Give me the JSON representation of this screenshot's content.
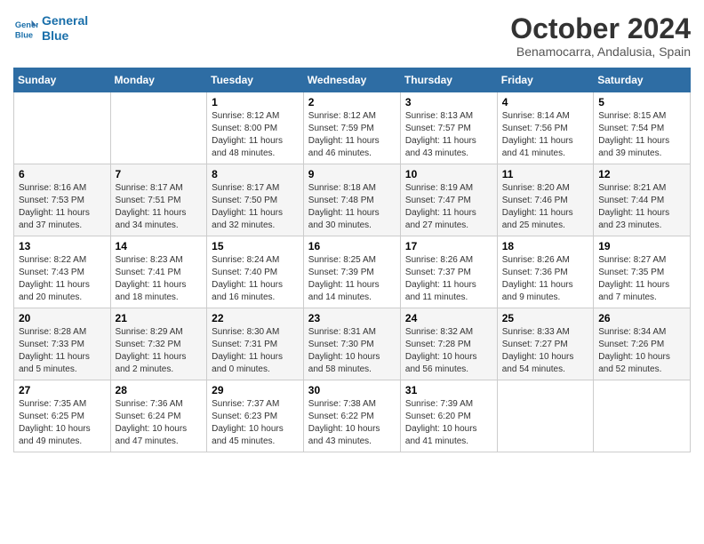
{
  "header": {
    "logo_line1": "General",
    "logo_line2": "Blue",
    "title": "October 2024",
    "subtitle": "Benamocarra, Andalusia, Spain"
  },
  "columns": [
    "Sunday",
    "Monday",
    "Tuesday",
    "Wednesday",
    "Thursday",
    "Friday",
    "Saturday"
  ],
  "weeks": [
    [
      {
        "day": "",
        "sunrise": "",
        "sunset": "",
        "daylight": ""
      },
      {
        "day": "",
        "sunrise": "",
        "sunset": "",
        "daylight": ""
      },
      {
        "day": "1",
        "sunrise": "Sunrise: 8:12 AM",
        "sunset": "Sunset: 8:00 PM",
        "daylight": "Daylight: 11 hours and 48 minutes."
      },
      {
        "day": "2",
        "sunrise": "Sunrise: 8:12 AM",
        "sunset": "Sunset: 7:59 PM",
        "daylight": "Daylight: 11 hours and 46 minutes."
      },
      {
        "day": "3",
        "sunrise": "Sunrise: 8:13 AM",
        "sunset": "Sunset: 7:57 PM",
        "daylight": "Daylight: 11 hours and 43 minutes."
      },
      {
        "day": "4",
        "sunrise": "Sunrise: 8:14 AM",
        "sunset": "Sunset: 7:56 PM",
        "daylight": "Daylight: 11 hours and 41 minutes."
      },
      {
        "day": "5",
        "sunrise": "Sunrise: 8:15 AM",
        "sunset": "Sunset: 7:54 PM",
        "daylight": "Daylight: 11 hours and 39 minutes."
      }
    ],
    [
      {
        "day": "6",
        "sunrise": "Sunrise: 8:16 AM",
        "sunset": "Sunset: 7:53 PM",
        "daylight": "Daylight: 11 hours and 37 minutes."
      },
      {
        "day": "7",
        "sunrise": "Sunrise: 8:17 AM",
        "sunset": "Sunset: 7:51 PM",
        "daylight": "Daylight: 11 hours and 34 minutes."
      },
      {
        "day": "8",
        "sunrise": "Sunrise: 8:17 AM",
        "sunset": "Sunset: 7:50 PM",
        "daylight": "Daylight: 11 hours and 32 minutes."
      },
      {
        "day": "9",
        "sunrise": "Sunrise: 8:18 AM",
        "sunset": "Sunset: 7:48 PM",
        "daylight": "Daylight: 11 hours and 30 minutes."
      },
      {
        "day": "10",
        "sunrise": "Sunrise: 8:19 AM",
        "sunset": "Sunset: 7:47 PM",
        "daylight": "Daylight: 11 hours and 27 minutes."
      },
      {
        "day": "11",
        "sunrise": "Sunrise: 8:20 AM",
        "sunset": "Sunset: 7:46 PM",
        "daylight": "Daylight: 11 hours and 25 minutes."
      },
      {
        "day": "12",
        "sunrise": "Sunrise: 8:21 AM",
        "sunset": "Sunset: 7:44 PM",
        "daylight": "Daylight: 11 hours and 23 minutes."
      }
    ],
    [
      {
        "day": "13",
        "sunrise": "Sunrise: 8:22 AM",
        "sunset": "Sunset: 7:43 PM",
        "daylight": "Daylight: 11 hours and 20 minutes."
      },
      {
        "day": "14",
        "sunrise": "Sunrise: 8:23 AM",
        "sunset": "Sunset: 7:41 PM",
        "daylight": "Daylight: 11 hours and 18 minutes."
      },
      {
        "day": "15",
        "sunrise": "Sunrise: 8:24 AM",
        "sunset": "Sunset: 7:40 PM",
        "daylight": "Daylight: 11 hours and 16 minutes."
      },
      {
        "day": "16",
        "sunrise": "Sunrise: 8:25 AM",
        "sunset": "Sunset: 7:39 PM",
        "daylight": "Daylight: 11 hours and 14 minutes."
      },
      {
        "day": "17",
        "sunrise": "Sunrise: 8:26 AM",
        "sunset": "Sunset: 7:37 PM",
        "daylight": "Daylight: 11 hours and 11 minutes."
      },
      {
        "day": "18",
        "sunrise": "Sunrise: 8:26 AM",
        "sunset": "Sunset: 7:36 PM",
        "daylight": "Daylight: 11 hours and 9 minutes."
      },
      {
        "day": "19",
        "sunrise": "Sunrise: 8:27 AM",
        "sunset": "Sunset: 7:35 PM",
        "daylight": "Daylight: 11 hours and 7 minutes."
      }
    ],
    [
      {
        "day": "20",
        "sunrise": "Sunrise: 8:28 AM",
        "sunset": "Sunset: 7:33 PM",
        "daylight": "Daylight: 11 hours and 5 minutes."
      },
      {
        "day": "21",
        "sunrise": "Sunrise: 8:29 AM",
        "sunset": "Sunset: 7:32 PM",
        "daylight": "Daylight: 11 hours and 2 minutes."
      },
      {
        "day": "22",
        "sunrise": "Sunrise: 8:30 AM",
        "sunset": "Sunset: 7:31 PM",
        "daylight": "Daylight: 11 hours and 0 minutes."
      },
      {
        "day": "23",
        "sunrise": "Sunrise: 8:31 AM",
        "sunset": "Sunset: 7:30 PM",
        "daylight": "Daylight: 10 hours and 58 minutes."
      },
      {
        "day": "24",
        "sunrise": "Sunrise: 8:32 AM",
        "sunset": "Sunset: 7:28 PM",
        "daylight": "Daylight: 10 hours and 56 minutes."
      },
      {
        "day": "25",
        "sunrise": "Sunrise: 8:33 AM",
        "sunset": "Sunset: 7:27 PM",
        "daylight": "Daylight: 10 hours and 54 minutes."
      },
      {
        "day": "26",
        "sunrise": "Sunrise: 8:34 AM",
        "sunset": "Sunset: 7:26 PM",
        "daylight": "Daylight: 10 hours and 52 minutes."
      }
    ],
    [
      {
        "day": "27",
        "sunrise": "Sunrise: 7:35 AM",
        "sunset": "Sunset: 6:25 PM",
        "daylight": "Daylight: 10 hours and 49 minutes."
      },
      {
        "day": "28",
        "sunrise": "Sunrise: 7:36 AM",
        "sunset": "Sunset: 6:24 PM",
        "daylight": "Daylight: 10 hours and 47 minutes."
      },
      {
        "day": "29",
        "sunrise": "Sunrise: 7:37 AM",
        "sunset": "Sunset: 6:23 PM",
        "daylight": "Daylight: 10 hours and 45 minutes."
      },
      {
        "day": "30",
        "sunrise": "Sunrise: 7:38 AM",
        "sunset": "Sunset: 6:22 PM",
        "daylight": "Daylight: 10 hours and 43 minutes."
      },
      {
        "day": "31",
        "sunrise": "Sunrise: 7:39 AM",
        "sunset": "Sunset: 6:20 PM",
        "daylight": "Daylight: 10 hours and 41 minutes."
      },
      {
        "day": "",
        "sunrise": "",
        "sunset": "",
        "daylight": ""
      },
      {
        "day": "",
        "sunrise": "",
        "sunset": "",
        "daylight": ""
      }
    ]
  ]
}
